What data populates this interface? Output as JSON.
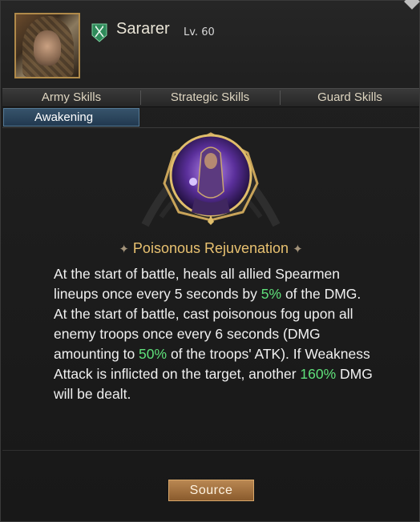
{
  "hero": {
    "name": "Sararer",
    "level": "Lv. 60"
  },
  "tabs": [
    "Army Skills",
    "Strategic Skills",
    "Guard Skills"
  ],
  "subtab": "Awakening",
  "skill": {
    "title": "Poisonous Rejuvenation",
    "desc1": {
      "a": "At the start of battle, heals all allied Spearmen lineups once every 5 seconds by ",
      "b": "5%",
      "c": " of the DMG."
    },
    "desc2": {
      "a": "At the start of battle, cast poisonous fog upon all enemy troops once every 6 seconds (DMG amounting to ",
      "b": "50%",
      "c": " of the troops' ATK). If Weakness Attack is inflicted on the target, another ",
      "d": "160%",
      "e": " DMG will be dealt."
    }
  },
  "source_button": "Source",
  "colors": {
    "highlight": "#5fe07a",
    "title_gold": "#e8c170",
    "tab_active": "#2e4a63"
  }
}
